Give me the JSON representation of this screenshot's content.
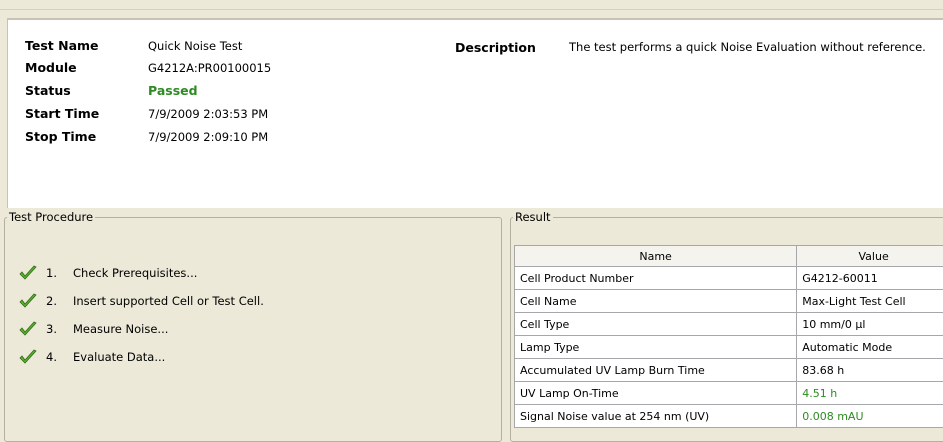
{
  "info": {
    "test_name": {
      "label": "Test Name",
      "value": "Quick Noise Test"
    },
    "module": {
      "label": "Module",
      "value": "G4212A:PR00100015"
    },
    "status": {
      "label": "Status",
      "value": "Passed"
    },
    "start_time": {
      "label": "Start Time",
      "value": "7/9/2009 2:03:53 PM"
    },
    "stop_time": {
      "label": "Stop Time",
      "value": "7/9/2009 2:09:10 PM"
    },
    "description": {
      "label": "Description",
      "value": "The test performs a quick Noise Evaluation without reference."
    }
  },
  "procedure": {
    "title": "Test Procedure",
    "steps": [
      {
        "num": "1.",
        "text": "Check Prerequisites...",
        "icon": "checkmark-icon"
      },
      {
        "num": "2.",
        "text": "Insert supported Cell or Test Cell.",
        "icon": "checkmark-icon"
      },
      {
        "num": "3.",
        "text": "Measure Noise...",
        "icon": "checkmark-icon"
      },
      {
        "num": "4.",
        "text": "Evaluate Data...",
        "icon": "checkmark-icon"
      }
    ]
  },
  "result": {
    "title": "Result",
    "headers": {
      "name": "Name",
      "value": "Value"
    },
    "rows": [
      {
        "name": "Cell Product Number",
        "value": "G4212-60011"
      },
      {
        "name": "Cell Name",
        "value": "Max-Light Test Cell"
      },
      {
        "name": "Cell Type",
        "value": "10 mm/0 µl"
      },
      {
        "name": "Lamp Type",
        "value": "Automatic Mode"
      },
      {
        "name": "Accumulated UV Lamp Burn Time",
        "value": "83.68 h"
      },
      {
        "name": "UV Lamp On-Time",
        "value": "4.51 h"
      },
      {
        "name": "Signal Noise value at 254 nm (UV)",
        "value": "0.008 mAU"
      }
    ]
  },
  "colors": {
    "passed": "#2e8b22",
    "check": "#5cae2c"
  }
}
